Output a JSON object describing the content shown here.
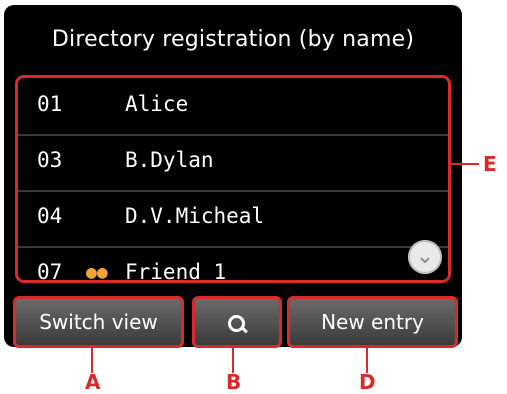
{
  "screen": {
    "title": "Directory registration (by name)"
  },
  "list": {
    "rows": [
      {
        "number": "01",
        "name": "Alice",
        "group": false
      },
      {
        "number": "03",
        "name": "B.Dylan",
        "group": false
      },
      {
        "number": "04",
        "name": "D.V.Micheal",
        "group": false
      },
      {
        "number": "07",
        "name": "Friend 1",
        "group": true
      }
    ],
    "scroll_icon": "chevron-down-icon"
  },
  "buttons": {
    "switch_view": "Switch view",
    "search_icon": "search-icon",
    "new_entry": "New entry"
  },
  "callouts": {
    "a": "A",
    "b": "B",
    "d": "D",
    "e": "E"
  },
  "colors": {
    "accent": "#d92a2a",
    "screen_bg": "#000000",
    "group_icon": "#f2a533"
  }
}
